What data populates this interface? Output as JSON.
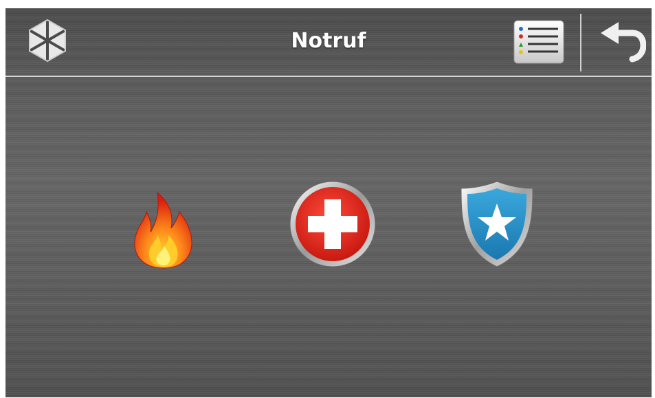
{
  "header": {
    "title": "Notruf",
    "icons": {
      "logo": "satel-logo-icon",
      "list": "event-list-icon",
      "back": "back-arrow-icon"
    }
  },
  "emergency_buttons": [
    {
      "icon": "fire-icon",
      "color": "#e8301a"
    },
    {
      "icon": "medical-cross-icon",
      "color": "#d9241c"
    },
    {
      "icon": "police-badge-icon",
      "color": "#1f8fc4"
    }
  ],
  "colors": {
    "background": "#5a5a5a",
    "title_text": "#ffffff",
    "header_line": "#d6d6d6"
  }
}
